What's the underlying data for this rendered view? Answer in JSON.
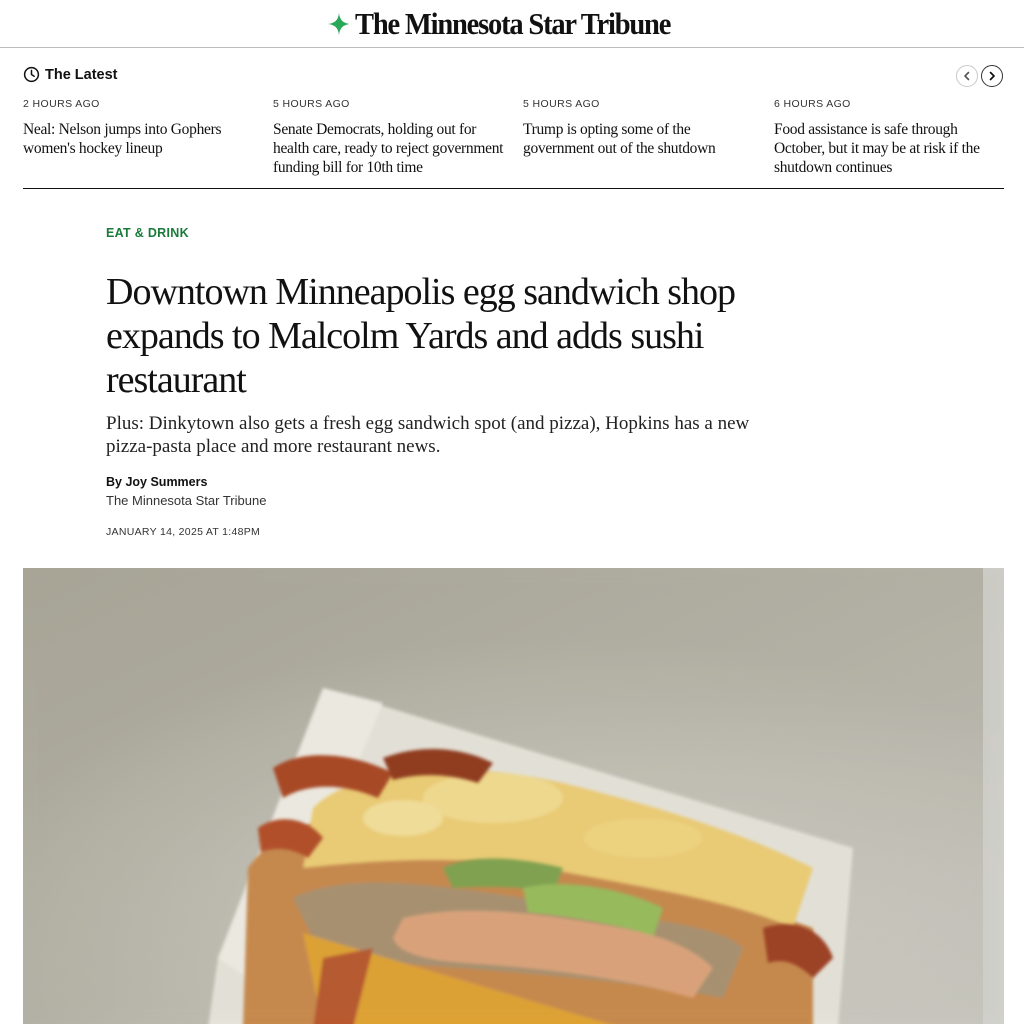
{
  "masthead": {
    "brand_name": "The Minnesota Star Tribune",
    "brand_color": "#2aa85a",
    "logo_icon": "four-point-star-icon"
  },
  "latest": {
    "title": "The Latest",
    "icon": "clock-icon",
    "prev_icon": "chevron-left-icon",
    "next_icon": "chevron-right-icon",
    "stories": [
      {
        "time": "2 HOURS AGO",
        "headline": "Neal: Nelson jumps into Gophers women's hockey lineup"
      },
      {
        "time": "5 HOURS AGO",
        "headline": "Senate Democrats, holding out for health care, ready to reject government funding bill for 10th time"
      },
      {
        "time": "5 HOURS AGO",
        "headline": "Trump is opting some of the government out of the shutdown"
      },
      {
        "time": "6 HOURS AGO",
        "headline": "Food assistance is safe through October, but it may be at risk if the shutdown continues"
      }
    ]
  },
  "article": {
    "section": "EAT & DRINK",
    "section_color": "#1a7a3a",
    "headline": "Downtown Minneapolis egg sandwich shop expands to Malcolm Yards and adds sushi restaurant",
    "dek": "Plus: Dinkytown also gets a fresh egg sandwich spot (and pizza), Hopkins has a new pizza-pasta place and more restaurant news.",
    "byline_prefix": "By ",
    "author": "Joy Summers",
    "publication": "The Minnesota Star Tribune",
    "date": "JANUARY 14, 2025 AT 1:48PM"
  },
  "hero_image": {
    "subject": "egg sandwich photo"
  }
}
